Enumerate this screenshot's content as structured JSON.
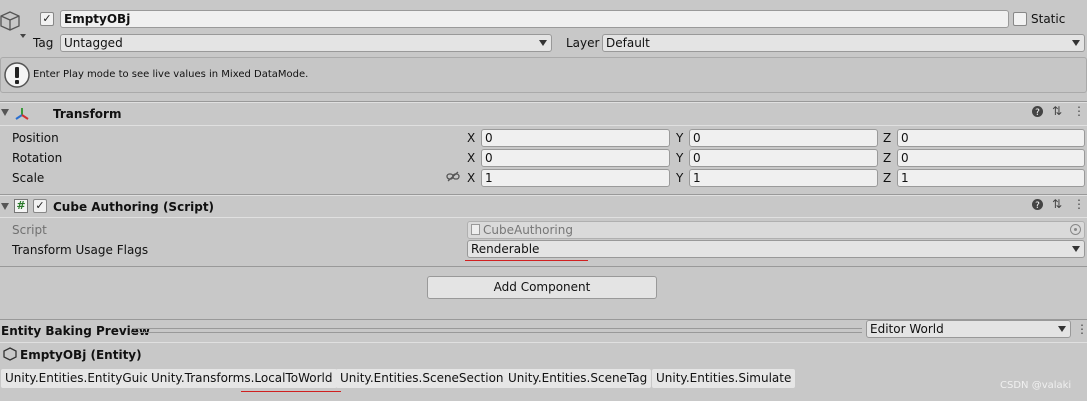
{
  "object": {
    "name": "EmptyOBj",
    "active_checked": "✓",
    "static_label": "Static",
    "tag_label": "Tag",
    "tag_value": "Untagged",
    "layer_label": "Layer",
    "layer_value": "Default"
  },
  "info": {
    "message": "Enter Play mode to see live values in Mixed DataMode."
  },
  "transform": {
    "title": "Transform",
    "rows": [
      {
        "label": "Position",
        "x": "0",
        "y": "0",
        "z": "0"
      },
      {
        "label": "Rotation",
        "x": "0",
        "y": "0",
        "z": "0"
      },
      {
        "label": "Scale",
        "x": "1",
        "y": "1",
        "z": "1"
      }
    ],
    "axis_x": "X",
    "axis_y": "Y",
    "axis_z": "Z"
  },
  "cube_authoring": {
    "title": "Cube Authoring (Script)",
    "enabled_checked": "✓",
    "script_label": "Script",
    "script_value": "CubeAuthoring",
    "flags_label": "Transform Usage Flags",
    "flags_value": "Renderable"
  },
  "add_component": {
    "label": "Add Component"
  },
  "baking_preview": {
    "title": "Entity Baking Preview",
    "world_value": "Editor World",
    "entity_name": "EmptyOBj (Entity)",
    "components": [
      "Unity.Entities.EntityGuid",
      "Unity.Transforms.LocalToWorld",
      "Unity.Entities.SceneSection",
      "Unity.Entities.SceneTag",
      "Unity.Entities.Simulate"
    ]
  },
  "watermark": "CSDN @valaki",
  "colors": {
    "background": "#c8c8c8",
    "field": "#f0f0f0",
    "highlight_line": "#d02020"
  },
  "icons": [
    "gameobject-cube-icon",
    "info-exclamation-icon",
    "transform-axis-icon",
    "script-hash-icon",
    "help-icon",
    "presets-icon",
    "kebab-menu-icon",
    "link-scale-icon",
    "object-picker-icon",
    "entity-hexagon-icon"
  ]
}
